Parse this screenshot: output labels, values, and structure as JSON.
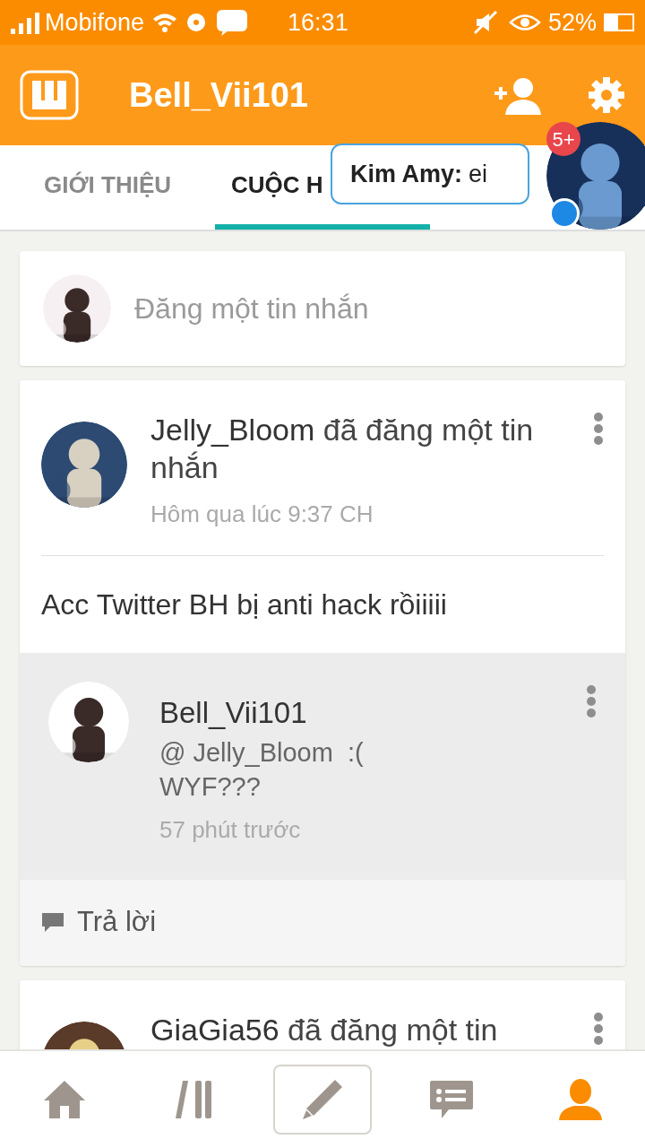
{
  "status_bar": {
    "carrier": "Mobifone",
    "time": "16:31",
    "battery": "52%"
  },
  "app_bar": {
    "title": "Bell_Vii101"
  },
  "tabs": [
    {
      "label": "GIỚI THIỆU",
      "selected": false
    },
    {
      "label": "CUỘC H",
      "selected": true
    }
  ],
  "chat_head": {
    "badge": "5+",
    "sender": "Kim Amy:",
    "message": "ei"
  },
  "composer": {
    "placeholder": "Đăng một tin nhắn"
  },
  "posts": [
    {
      "author": "Jelly_Bloom",
      "action": "đã đăng một tin nhắn",
      "time": "Hôm qua lúc 9:37 CH",
      "body": "Acc Twitter BH bị anti hack rồiiiii",
      "replies": [
        {
          "author": "Bell_Vii101",
          "lines": [
            "@ Jelly_Bloom  :(",
            "WYF???"
          ],
          "time": "57 phút trước"
        }
      ],
      "reply_label": "Trả lời"
    },
    {
      "author": "GiaGia56",
      "action": "đã đăng một tin"
    }
  ],
  "bottom_nav": [
    {
      "kind": "home",
      "selected": false
    },
    {
      "kind": "library",
      "selected": false
    },
    {
      "kind": "write",
      "selected": false
    },
    {
      "kind": "messages",
      "selected": false
    },
    {
      "kind": "profile",
      "selected": true
    }
  ]
}
